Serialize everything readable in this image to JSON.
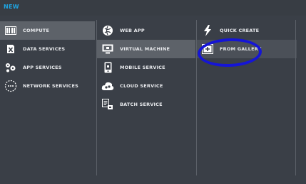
{
  "header": {
    "title": "NEW"
  },
  "categories": [
    {
      "label": "COMPUTE",
      "icon": "compute-icon"
    },
    {
      "label": "DATA SERVICES",
      "icon": "data-services-icon"
    },
    {
      "label": "APP SERVICES",
      "icon": "app-services-icon"
    },
    {
      "label": "NETWORK SERVICES",
      "icon": "network-services-icon"
    }
  ],
  "compute_options": [
    {
      "label": "WEB APP",
      "icon": "web-app-icon"
    },
    {
      "label": "VIRTUAL MACHINE",
      "icon": "virtual-machine-icon"
    },
    {
      "label": "MOBILE SERVICE",
      "icon": "mobile-service-icon"
    },
    {
      "label": "CLOUD SERVICE",
      "icon": "cloud-service-icon"
    },
    {
      "label": "BATCH SERVICE",
      "icon": "batch-service-icon"
    }
  ],
  "create_options": [
    {
      "label": "QUICK CREATE",
      "icon": "lightning-icon"
    },
    {
      "label": "FROM GALLERY",
      "icon": "gallery-icon"
    }
  ],
  "colors": {
    "accent": "#1fa3e0",
    "background": "#3a3f47",
    "selected": "#5d6269",
    "annotation": "#1515d6"
  }
}
